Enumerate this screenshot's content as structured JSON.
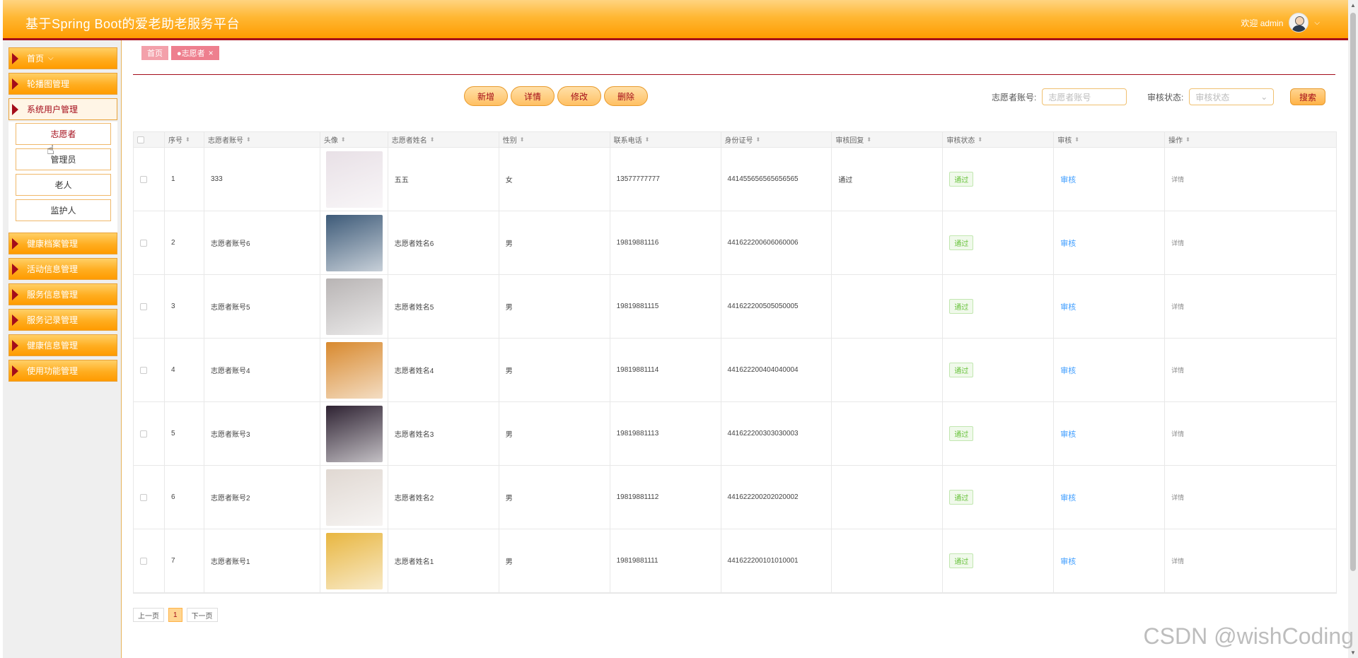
{
  "header": {
    "title": "基于Spring Boot的爱老助老服务平台",
    "welcome": "欢迎 admin",
    "dropdown": "⌵"
  },
  "sidebar": {
    "items": [
      {
        "label": "首页",
        "suffix": "⌵"
      },
      {
        "label": "轮播图管理"
      },
      {
        "label": "系统用户管理"
      },
      {
        "label": "健康档案管理"
      },
      {
        "label": "活动信息管理"
      },
      {
        "label": "服务信息管理"
      },
      {
        "label": "服务记录管理"
      },
      {
        "label": "健康信息管理"
      },
      {
        "label": "使用功能管理"
      }
    ],
    "submenu": [
      "志愿者",
      "管理员",
      "老人",
      "监护人"
    ]
  },
  "tabs": [
    {
      "label": "首页"
    },
    {
      "label": "●志愿者",
      "close": "×"
    }
  ],
  "toolbar": {
    "add": "新增",
    "detail": "详情",
    "edit": "修改",
    "delete": "删除"
  },
  "search": {
    "account_label": "志愿者账号:",
    "account_placeholder": "志愿者账号",
    "status_label": "审核状态:",
    "status_placeholder": "审核状态",
    "button": "搜索"
  },
  "table": {
    "columns": [
      "序号",
      "志愿者账号",
      "头像",
      "志愿者姓名",
      "性别",
      "联系电话",
      "身份证号",
      "审核回复",
      "审核状态",
      "审核",
      "操作"
    ],
    "rows": [
      {
        "index": "1",
        "account": "333",
        "name": "五五",
        "gender": "女",
        "phone": "13577777777",
        "idcard": "441455656565656565",
        "reply": "通过",
        "status": "通过",
        "review": "审核",
        "op": "详情",
        "avatar_color": "#e8e0e6"
      },
      {
        "index": "2",
        "account": "志愿者账号6",
        "name": "志愿者姓名6",
        "gender": "男",
        "phone": "19819881116",
        "idcard": "441622200606060006",
        "reply": "",
        "status": "通过",
        "review": "审核",
        "op": "详情",
        "avatar_color": "#3d5a78"
      },
      {
        "index": "3",
        "account": "志愿者账号5",
        "name": "志愿者姓名5",
        "gender": "男",
        "phone": "19819881115",
        "idcard": "441622200505050005",
        "reply": "",
        "status": "通过",
        "review": "审核",
        "op": "详情",
        "avatar_color": "#b8b4b4"
      },
      {
        "index": "4",
        "account": "志愿者账号4",
        "name": "志愿者姓名4",
        "gender": "男",
        "phone": "19819881114",
        "idcard": "441622200404040004",
        "reply": "",
        "status": "通过",
        "review": "审核",
        "op": "详情",
        "avatar_color": "#d8892e"
      },
      {
        "index": "5",
        "account": "志愿者账号3",
        "name": "志愿者姓名3",
        "gender": "男",
        "phone": "19819881113",
        "idcard": "441622200303030003",
        "reply": "",
        "status": "通过",
        "review": "审核",
        "op": "详情",
        "avatar_color": "#2e2232"
      },
      {
        "index": "6",
        "account": "志愿者账号2",
        "name": "志愿者姓名2",
        "gender": "男",
        "phone": "19819881112",
        "idcard": "441622200202020002",
        "reply": "",
        "status": "通过",
        "review": "审核",
        "op": "详情",
        "avatar_color": "#e0d8d2"
      },
      {
        "index": "7",
        "account": "志愿者账号1",
        "name": "志愿者姓名1",
        "gender": "男",
        "phone": "19819881111",
        "idcard": "441622200101010001",
        "reply": "",
        "status": "通过",
        "review": "审核",
        "op": "详情",
        "avatar_color": "#e8b640"
      }
    ]
  },
  "pagination": {
    "prev": "上一页",
    "current": "1",
    "next": "下一页"
  },
  "watermark": "CSDN @wishCoding"
}
